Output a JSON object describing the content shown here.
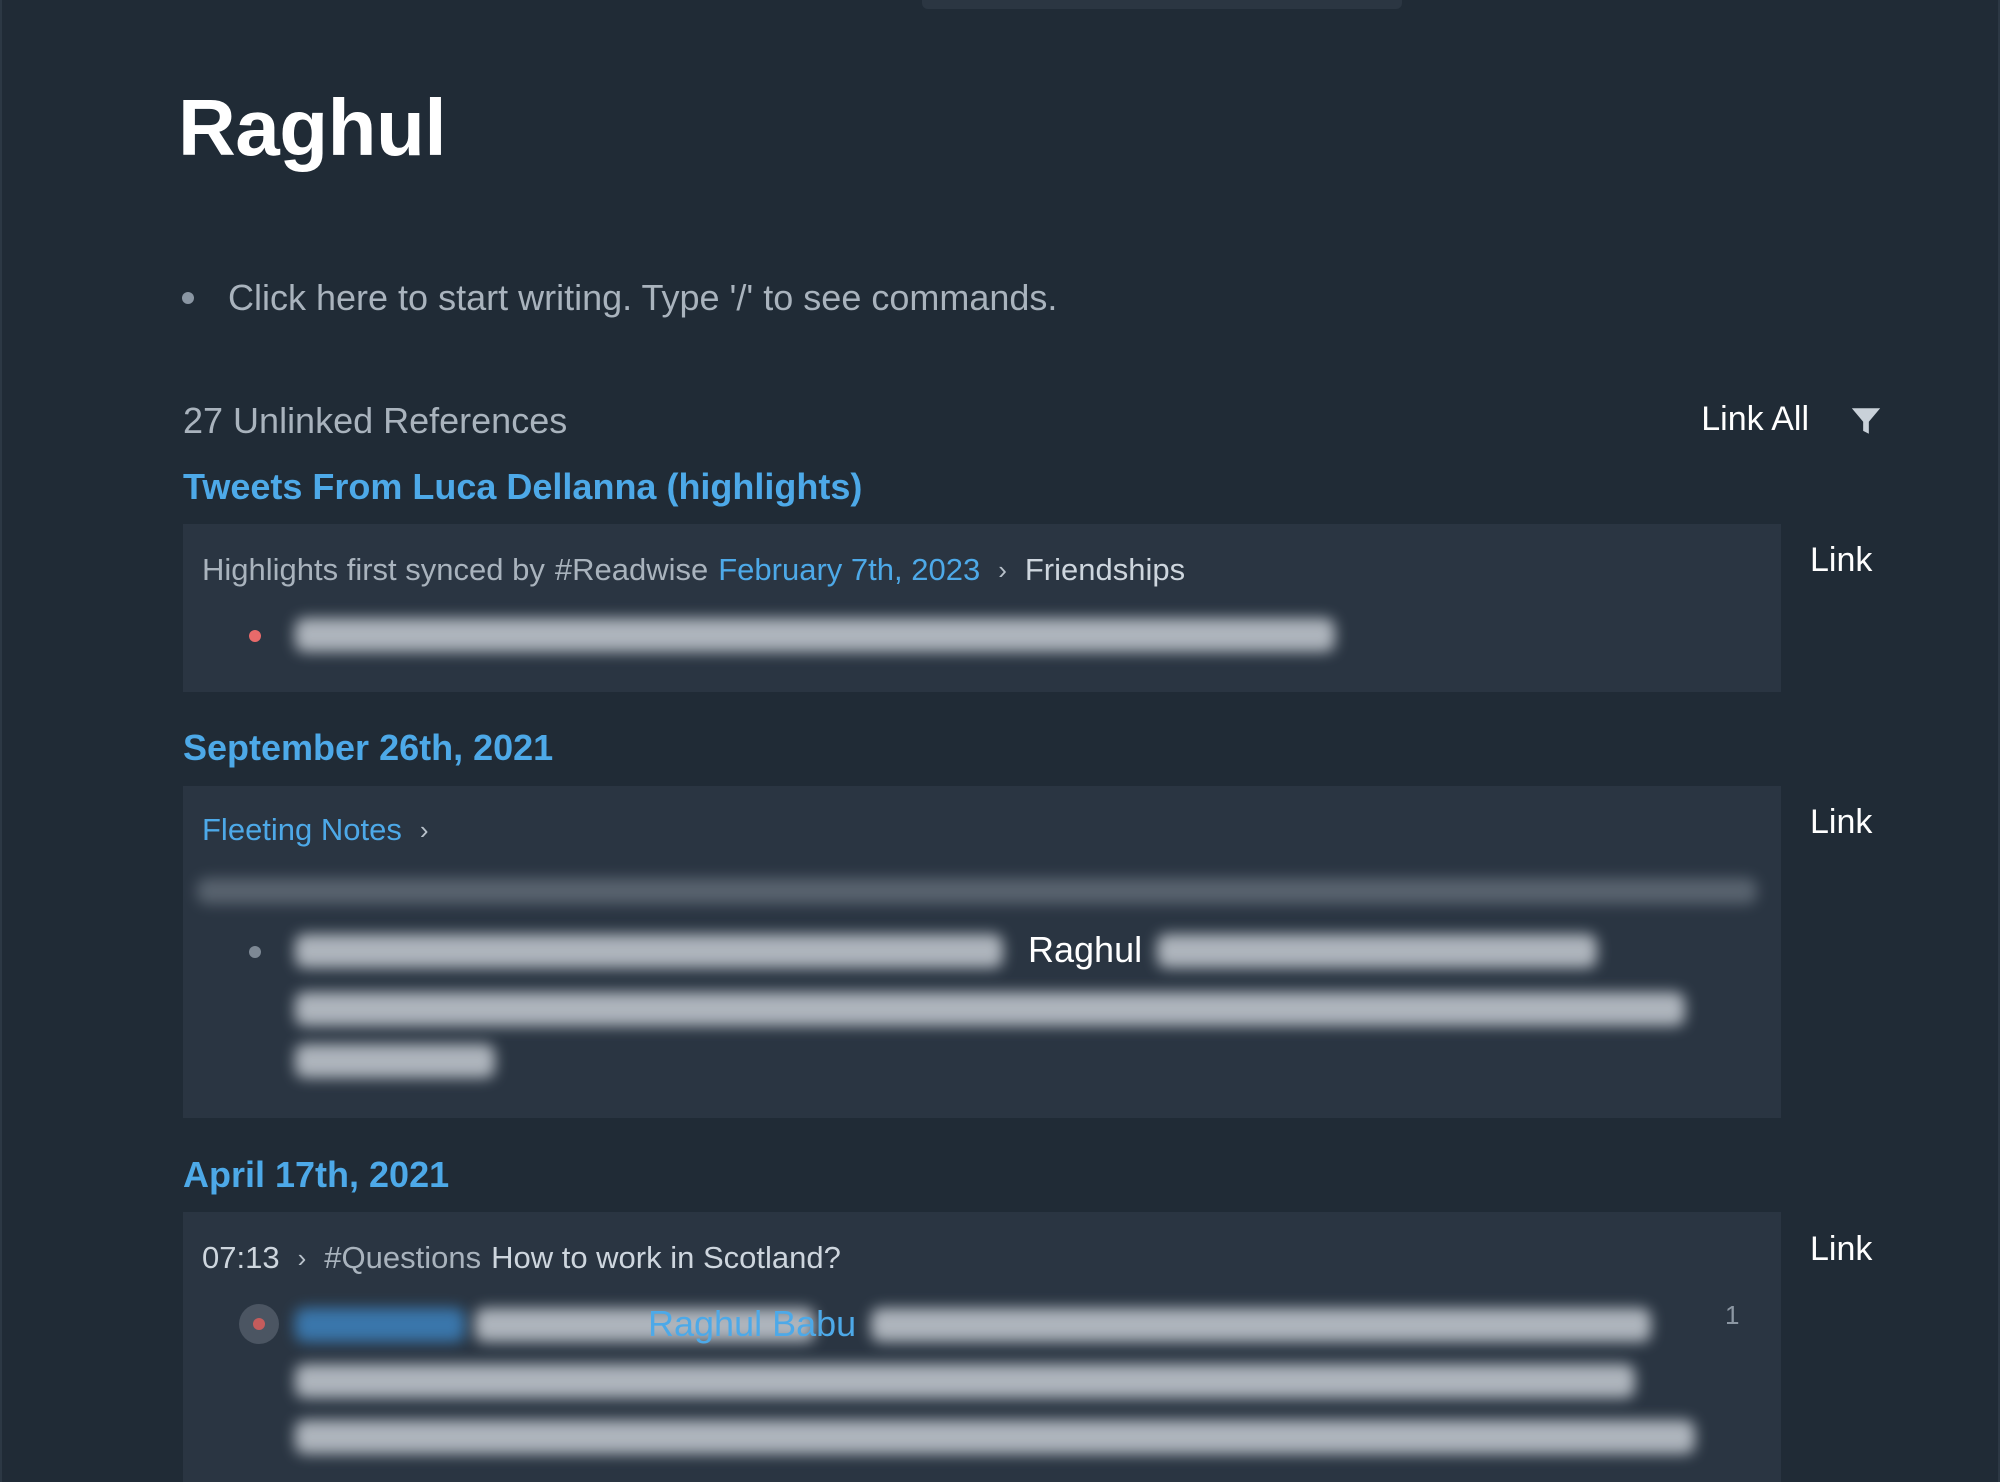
{
  "page": {
    "title": "Raghul",
    "placeholder": "Click here to start writing. Type '/' to see commands."
  },
  "unlinked_refs": {
    "count_label": "27 Unlinked References",
    "link_all_label": "Link All",
    "filter_icon": "filter-funnel-icon"
  },
  "groups": [
    {
      "title": "Tweets From Luca Dellanna (highlights)",
      "link_label": "Link",
      "breadcrumb": {
        "prefix": "Highlights first synced by",
        "tag": "#Readwise",
        "date": "February 7th, 2023",
        "chevron": "›",
        "page": "Friendships"
      }
    },
    {
      "title": "September 26th, 2021",
      "link_label": "Link",
      "breadcrumb": {
        "page": "Fleeting Notes",
        "chevron": "›"
      },
      "visible_text": "Raghul"
    },
    {
      "title": "April 17th, 2021",
      "link_label": "Link",
      "breadcrumb": {
        "time": "07:13",
        "chevron": "›",
        "tag": "#Questions",
        "question": "How to work in Scotland?"
      },
      "visible_link": "Raghul Babu",
      "child_count": "1"
    }
  ],
  "colors": {
    "background": "#202b36",
    "card": "#2a3542",
    "accent_blue": "#4da9e8",
    "bullet_red": "#e86a6a"
  }
}
